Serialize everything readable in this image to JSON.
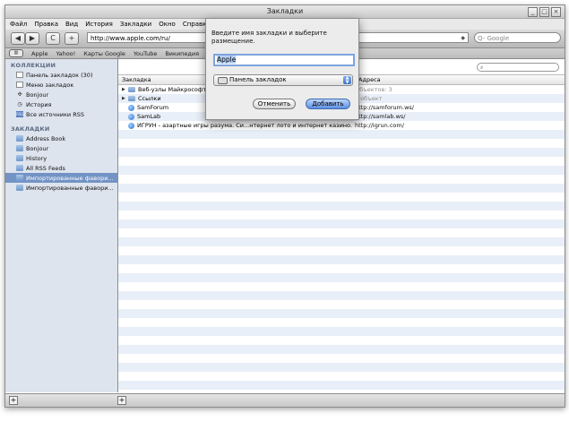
{
  "window": {
    "title": "Закладки"
  },
  "menu": [
    "Файл",
    "Правка",
    "Вид",
    "История",
    "Закладки",
    "Окно",
    "Справка"
  ],
  "toolbar": {
    "back": "◀",
    "forward": "▶",
    "reload": "C",
    "add": "+",
    "url": "http://www.apple.com/ru/",
    "search_placeholder": "Q- Google"
  },
  "bookmarks_bar": {
    "items": [
      "Apple",
      "Yahoo!",
      "Карты Google",
      "YouTube",
      "Википедия"
    ]
  },
  "sidebar": {
    "collections_header": "КОЛЛЕКЦИИ",
    "collections": [
      {
        "label": "Панель закладок (30)",
        "icon": "bookmarks-bar-icon"
      },
      {
        "label": "Меню закладок",
        "icon": "bookmarks-menu-icon"
      },
      {
        "label": "Bonjour",
        "icon": "bonjour-icon"
      },
      {
        "label": "История",
        "icon": "history-clock-icon"
      },
      {
        "label": "Все источники RSS",
        "icon": "rss-icon"
      }
    ],
    "bookmarks_header": "ЗАКЛАДКИ",
    "bookmarks": [
      {
        "label": "Address Book"
      },
      {
        "label": "Bonjour"
      },
      {
        "label": "History"
      },
      {
        "label": "All RSS Feeds"
      },
      {
        "label": "Импортированные фавори...",
        "selected": true
      },
      {
        "label": "Импортированные фавори..."
      }
    ]
  },
  "table": {
    "col_name": "Закладка",
    "col_address": "Адреса",
    "rows": [
      {
        "name": "Веб-узлы Майкрософт",
        "address": "Объектов: 3",
        "type": "folder"
      },
      {
        "name": "Ссылки",
        "address": "1 объект",
        "type": "folder"
      },
      {
        "name": "SamForum",
        "address": "http://samforum.ws/",
        "type": "link"
      },
      {
        "name": "SamLab",
        "address": "http://samlab.ws/",
        "type": "link"
      },
      {
        "name": "ИГРУН - азартные игры разума. Си...нтернет лото и интернет казино.",
        "address": "http://igrun.com/",
        "type": "link"
      }
    ]
  },
  "dialog": {
    "prompt": "Введите имя закладки и выберите размещение.",
    "name_value": "Apple",
    "location_value": "Панель закладок",
    "cancel_label": "Отменить",
    "ok_label": "Добавить"
  }
}
